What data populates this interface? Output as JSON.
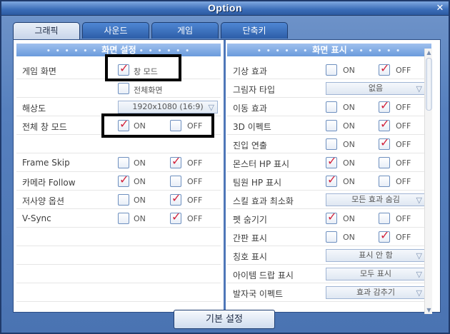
{
  "window": {
    "title": "Option",
    "close_glyph": "✕"
  },
  "tabs": [
    "그래픽",
    "사운드",
    "게임",
    "단축키"
  ],
  "left": {
    "header": "화면 설정",
    "game_screen": {
      "label": "게임 화면",
      "window_mode": "창 모드",
      "fullscreen": "전체화면"
    },
    "resolution": {
      "label": "해상도",
      "value": "1920x1080 (16:9)"
    },
    "fullwindow": {
      "label": "전체 창 모드",
      "on": "ON",
      "off": "OFF"
    },
    "frame_skip": {
      "label": "Frame Skip",
      "on": "ON",
      "off": "OFF"
    },
    "camera_follow": {
      "label": "카메라 Follow",
      "on": "ON",
      "off": "OFF"
    },
    "low_spec": {
      "label": "저사양 옵션",
      "on": "ON",
      "off": "OFF"
    },
    "vsync": {
      "label": "V-Sync",
      "on": "ON",
      "off": "OFF"
    }
  },
  "right": {
    "header": "화면 표시",
    "weather": {
      "label": "기상 효과",
      "on": "ON",
      "off": "OFF"
    },
    "shadow": {
      "label": "그림자 타입",
      "value": "없음"
    },
    "move_fx": {
      "label": "이동 효과",
      "on": "ON",
      "off": "OFF"
    },
    "fx3d": {
      "label": "3D 이펙트",
      "on": "ON",
      "off": "OFF"
    },
    "entry": {
      "label": "진입 연출",
      "on": "ON",
      "off": "OFF"
    },
    "monster_hp": {
      "label": "몬스터 HP 표시",
      "on": "ON",
      "off": "OFF"
    },
    "party_hp": {
      "label": "팀원 HP 표시",
      "on": "ON",
      "off": "OFF"
    },
    "skill_fx": {
      "label": "스킬 효과 최소화",
      "value": "모든 효과 숨김"
    },
    "pet_hide": {
      "label": "펫 숨기기",
      "on": "ON",
      "off": "OFF"
    },
    "sign": {
      "label": "간판 표시",
      "on": "ON",
      "off": "OFF"
    },
    "title_disp": {
      "label": "칭호 표시",
      "value": "표시 안 함"
    },
    "item_drop": {
      "label": "아이템 드랍 표시",
      "value": "모두 표시"
    },
    "footstep": {
      "label": "발자국 이펙트",
      "value": "효과 감추기"
    }
  },
  "footer": {
    "default_button": "기본 설정"
  },
  "icons": {
    "check": "check-icon",
    "dropdown": "chevron-down-icon",
    "close": "close-icon"
  }
}
